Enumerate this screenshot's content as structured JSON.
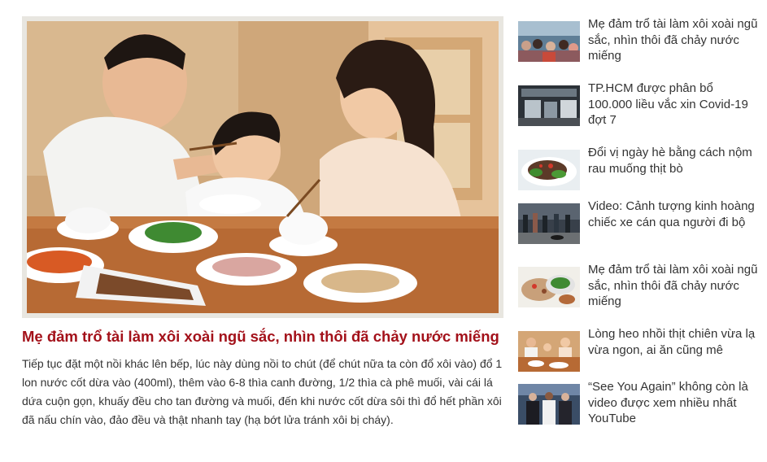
{
  "main": {
    "headline": "Mẹ đảm trổ tài làm xôi xoài ngũ sắc, nhìn thôi đã chảy nước miếng",
    "summary": "Tiếp tục đặt một nồi khác lên bếp, lúc này dùng nồi to chút (để chút nữa ta còn đổ xôi vào) đổ 1 lon nước cốt dừa vào (400ml), thêm vào 6-8 thìa canh đường, 1/2 thìa cà phê muối, vài cái lá dứa cuộn gọn, khuấy đều cho tan đường và muối, đến khi nước cốt dừa sôi thì đổ hết phần xôi đã nấu chín vào, đảo đều và thật nhanh tay (hạ bớt lửa tránh xôi bị cháy)."
  },
  "colors": {
    "headline": "#a3111a",
    "text": "#333333",
    "hero_frame": "#e8e6e0"
  },
  "sidebar": {
    "items": [
      {
        "title": "Mẹ đảm trổ tài làm xôi xoài ngũ sắc, nhìn thôi đã chảy nước miếng",
        "thumb": "crowd-street-thumbnail"
      },
      {
        "title": "TP.HCM được phân bổ 100.000 liều vắc xin Covid-19 đợt 7",
        "thumb": "warehouse-vaccine-thumbnail"
      },
      {
        "title": "Đổi vị ngày hè bằng cách nộm rau muống thịt bò",
        "thumb": "beef-salad-thumbnail"
      },
      {
        "title": "Video: Cảnh tượng kinh hoàng chiếc xe cán qua người đi bộ",
        "thumb": "street-accident-thumbnail"
      },
      {
        "title": "Mẹ đảm trổ tài làm xôi xoài ngũ sắc, nhìn thôi đã chảy nước miếng",
        "thumb": "food-platter-thumbnail"
      },
      {
        "title": "Lòng heo nhồi thịt chiên vừa lạ vừa ngon, ai ăn cũng mê",
        "thumb": "family-meal-thumbnail"
      },
      {
        "title": "“See You Again” không còn là video được xem nhiều nhất YouTube",
        "thumb": "music-video-thumbnail"
      }
    ]
  }
}
